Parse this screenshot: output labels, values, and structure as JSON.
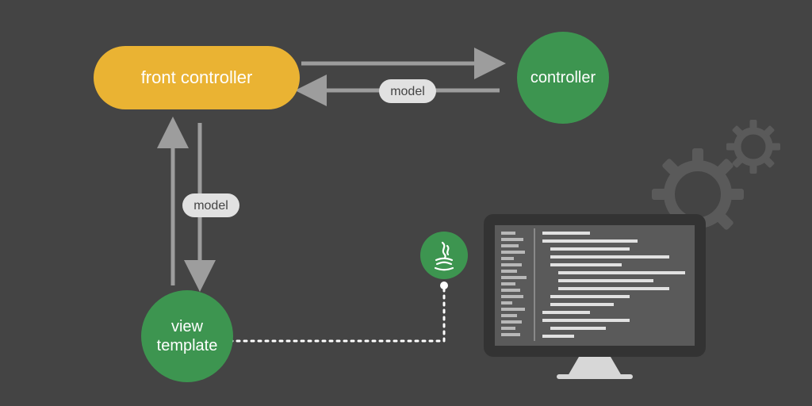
{
  "nodes": {
    "front_controller": {
      "label": "front controller",
      "shape": "pill",
      "fill": "#eab333"
    },
    "controller": {
      "label": "controller",
      "shape": "circle",
      "fill": "#3d9550"
    },
    "view_template": {
      "label_line1": "view",
      "label_line2": "template",
      "shape": "circle",
      "fill": "#3d9550"
    },
    "java": {
      "label": "java-icon",
      "shape": "circle",
      "fill": "#3d9550"
    }
  },
  "edge_labels": {
    "controller_to_front": "model",
    "front_to_view": "model"
  },
  "colors": {
    "bg": "#444444",
    "arrow": "#9d9d9d",
    "label_pill_fill": "#e1e1e1",
    "label_pill_text": "#444444",
    "node_text": "#ffffff",
    "gear": "#5a5a5a",
    "monitor_body": "#333333",
    "monitor_screen": "#5a5a5a",
    "monitor_stand": "#d7d7d7",
    "code_line": "#e1e1e1",
    "dotted": "#ffffff"
  }
}
